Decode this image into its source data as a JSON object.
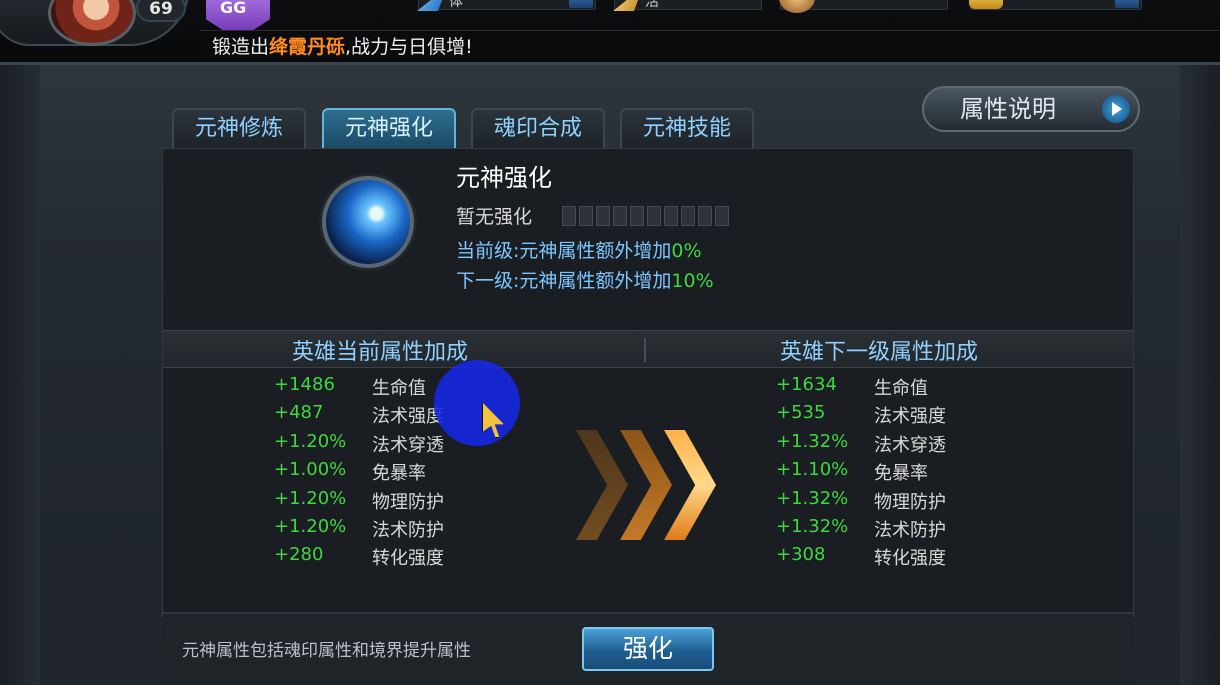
{
  "hud": {
    "player_level": "69",
    "vip_label": "GG",
    "ticker_prefix": "锻造出",
    "ticker_item": "绛霞丹砾",
    "ticker_suffix": ",战力与日俱增!",
    "res_stamina_label": "体",
    "res_vitality_label": "活"
  },
  "tabs": [
    {
      "label": "元神修炼"
    },
    {
      "label": "元神强化"
    },
    {
      "label": "魂印合成"
    },
    {
      "label": "元神技能"
    }
  ],
  "active_tab": "元神强化",
  "attr_info_button": "属性说明",
  "skill": {
    "title": "元神强化",
    "level_status": "暂无强化",
    "total_pips": 10,
    "filled_pips": 0,
    "current_prefix": "当前级:元神属性额外增加",
    "current_value": "0%",
    "next_prefix": "下一级:元神属性额外增加",
    "next_value": "10%"
  },
  "current_header": "英雄当前属性加成",
  "next_header": "英雄下一级属性加成",
  "current_stats": [
    {
      "value": "+1486",
      "name": "生命值"
    },
    {
      "value": "+487",
      "name": "法术强度"
    },
    {
      "value": "+1.20%",
      "name": "法术穿透"
    },
    {
      "value": "+1.00%",
      "name": "免暴率"
    },
    {
      "value": "+1.20%",
      "name": "物理防护"
    },
    {
      "value": "+1.20%",
      "name": "法术防护"
    },
    {
      "value": "+280",
      "name": "转化强度"
    }
  ],
  "next_stats": [
    {
      "value": "+1634",
      "name": "生命值"
    },
    {
      "value": "+535",
      "name": "法术强度"
    },
    {
      "value": "+1.32%",
      "name": "法术穿透"
    },
    {
      "value": "+1.10%",
      "name": "免暴率"
    },
    {
      "value": "+1.32%",
      "name": "物理防护"
    },
    {
      "value": "+1.32%",
      "name": "法术防护"
    },
    {
      "value": "+308",
      "name": "转化强度"
    }
  ],
  "footer_note": "元神属性包括魂印属性和境界提升属性",
  "enhance_button": "强化",
  "colors": {
    "accent_blue": "#8fd0ff",
    "stat_green": "#3fd73f",
    "highlight_orange": "#ff8a1e"
  }
}
